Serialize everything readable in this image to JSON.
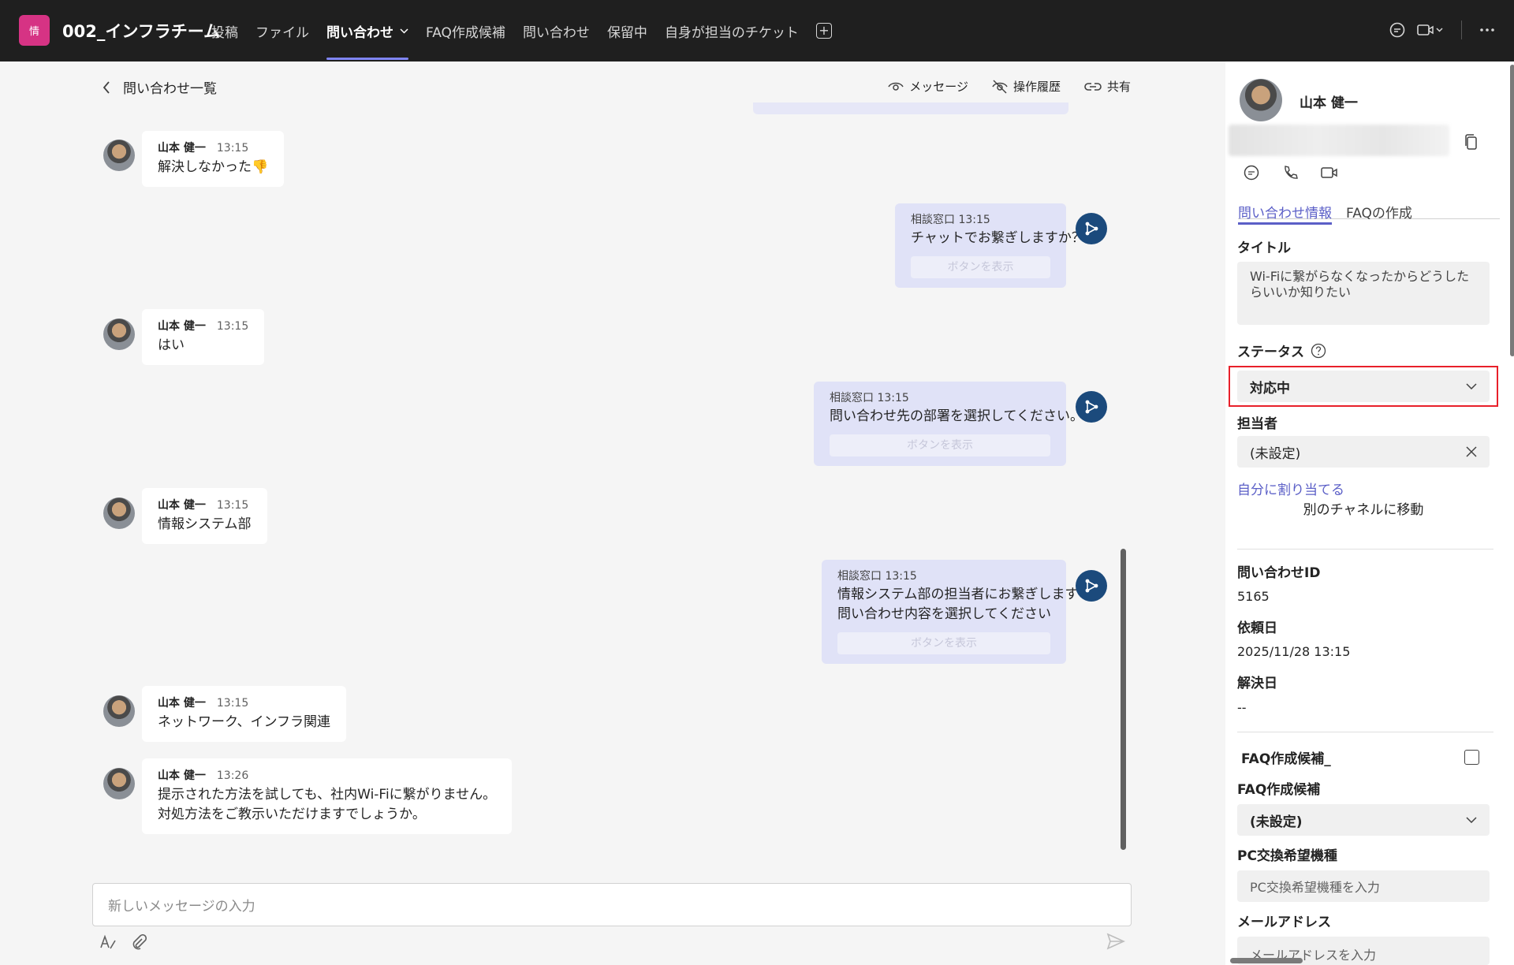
{
  "header": {
    "team_icon_text": "情",
    "team_name": "002_インフラチーム",
    "tabs": [
      {
        "label": "投稿"
      },
      {
        "label": "ファイル"
      },
      {
        "label": "問い合わせ",
        "active": true
      },
      {
        "label": "FAQ作成候補"
      },
      {
        "label": "問い合わせ"
      },
      {
        "label": "保留中"
      },
      {
        "label": "自身が担当のチケット"
      }
    ]
  },
  "left_header": {
    "back_label": "問い合わせ一覧",
    "actions": [
      {
        "label": "メッセージ",
        "icon": "eye-icon"
      },
      {
        "label": "操作履歴",
        "icon": "eye-off-icon"
      },
      {
        "label": "共有",
        "icon": "link-icon"
      }
    ]
  },
  "messages": [
    {
      "sender": "山本 健一",
      "time": "13:15",
      "lines": [
        "解決しなかった👎"
      ]
    },
    {
      "sender": "相談窓口",
      "time": "13:15",
      "lines": [
        "チャットでお繋ぎしますか？"
      ],
      "button": "ボタンを表示"
    },
    {
      "sender": "山本 健一",
      "time": "13:15",
      "lines": [
        "はい"
      ]
    },
    {
      "sender": "相談窓口",
      "time": "13:15",
      "lines": [
        "問い合わせ先の部署を選択してください。"
      ],
      "button": "ボタンを表示"
    },
    {
      "sender": "山本 健一",
      "time": "13:15",
      "lines": [
        "情報システム部"
      ]
    },
    {
      "sender": "相談窓口",
      "time": "13:15",
      "lines": [
        "情報システム部の担当者にお繋ぎします",
        "問い合わせ内容を選択してください"
      ],
      "button": "ボタンを表示"
    },
    {
      "sender": "山本 健一",
      "time": "13:15",
      "lines": [
        "ネットワーク、インフラ関連"
      ]
    },
    {
      "sender": "山本 健一",
      "time": "13:26",
      "lines": [
        "提示された方法を試しても、社内Wi-Fiに繋がりません。",
        "対処方法をご教示いただけますでしょうか。"
      ]
    }
  ],
  "compose": {
    "placeholder": "新しいメッセージの入力"
  },
  "panel": {
    "user_name": "山本 健一",
    "tabs": [
      "問い合わせ情報",
      "FAQの作成"
    ],
    "title_label": "タイトル",
    "title_value": "Wi-Fiに繋がらなくなったからどうしたらいいか知りたい",
    "status_label": "ステータス",
    "status_value": "対応中",
    "assignee_label": "担当者",
    "assignee_value": "(未設定)",
    "assign_self": "自分に割り当てる",
    "move_channel": "別のチャネルに移動",
    "inquiry_id_label": "問い合わせID",
    "inquiry_id": "5165",
    "request_date_label": "依頼日",
    "request_date": "2025/11/28 13:15",
    "resolve_date_label": "解決日",
    "resolve_date": "--",
    "faq_check_label": "FAQ作成候補_",
    "faq_label": "FAQ作成候補",
    "faq_value": "(未設定)",
    "pc_label": "PC交換希望機種",
    "pc_placeholder": "PC交換希望機種を入力",
    "mail_label": "メールアドレス",
    "mail_placeholder": "メールアドレスを入力"
  },
  "colors": {
    "accent": "#5b5fc7",
    "topbar": "#1f1f1f",
    "bot_bubble": "#e0e2f7",
    "highlight": "#e8202a"
  }
}
